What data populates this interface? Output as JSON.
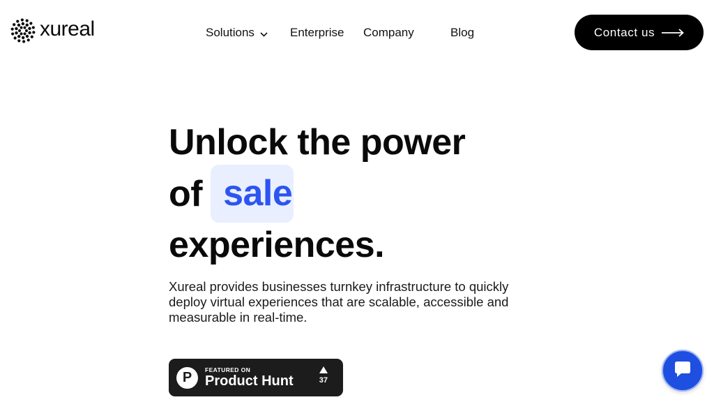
{
  "brand": {
    "name": "xureal",
    "logo_icon": "xureal-logo-icon"
  },
  "nav": {
    "items": [
      {
        "label": "Solutions",
        "has_dropdown": true
      },
      {
        "label": "Enterprise"
      },
      {
        "label": "Company"
      },
      {
        "label": "Blog"
      }
    ]
  },
  "contact_button": {
    "label": "Contact us",
    "icon": "arrow-right-icon"
  },
  "hero": {
    "line1": "Unlock the power",
    "line2_prefix": "of",
    "highlight_word": "sale",
    "line3": "experiences.",
    "description": "Xureal provides businesses turnkey infrastructure to quickly deploy virtual experiences that are scalable, accessible and measurable in real-time."
  },
  "product_hunt": {
    "logo_letter": "P",
    "featured_label": "FEATURED ON",
    "name": "Product Hunt",
    "votes": "37"
  },
  "chat": {
    "icon": "chat-bubble-icon"
  },
  "colors": {
    "primary_text": "#0a0a0a",
    "accent_blue": "#2c55f0",
    "highlight_bg": "#e9efff",
    "button_bg": "#000000",
    "chat_blue": "#1e4fe0",
    "badge_bg": "#1c1c1c"
  }
}
